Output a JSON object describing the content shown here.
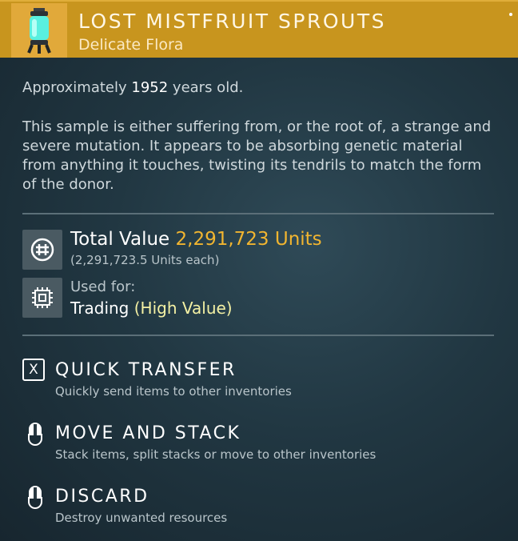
{
  "item": {
    "name": "LOST MISTFRUIT SPROUTS",
    "category": "Delicate Flora",
    "icon": "flora-canister-icon"
  },
  "age": {
    "prefix": "Approximately",
    "years": "1952",
    "suffix": "years old."
  },
  "description": "This sample is either suffering from, or the root of, a strange and severe mutation. It appears to be absorbing genetic material from anything it touches, twisting its tendrils to match the form of the donor.",
  "value": {
    "label": "Total Value",
    "amount": "2,291,723 Units",
    "each": "(2,291,723.5 Units each)"
  },
  "usage": {
    "label": "Used for:",
    "value": "Trading",
    "qualifier": "(High Value)"
  },
  "actions": [
    {
      "key": "X",
      "title": "QUICK TRANSFER",
      "desc": "Quickly send items to other inventories"
    },
    {
      "title": "MOVE AND STACK",
      "desc": "Stack items, split stacks or move to other inventories"
    },
    {
      "title": "DISCARD",
      "desc": "Destroy unwanted resources"
    }
  ],
  "colors": {
    "header": "#c8951e",
    "units": "#f1b530",
    "high_value": "#f4f1a4"
  }
}
